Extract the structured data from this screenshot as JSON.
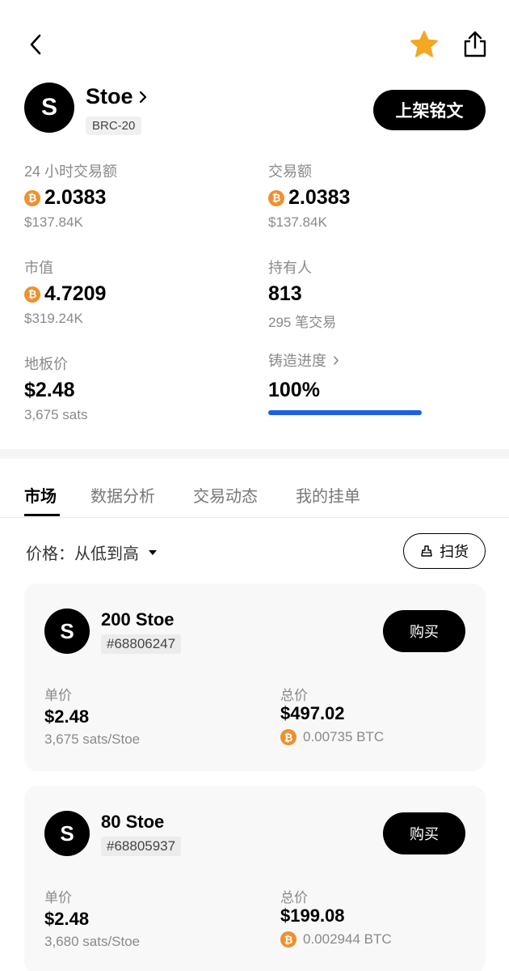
{
  "token": {
    "avatar_letter": "S",
    "name": "Stoe",
    "standard": "BRC-20",
    "list_button": "上架铭文"
  },
  "stats": {
    "volume_24h": {
      "label": "24 小时交易额",
      "value": "2.0383",
      "usd": "$137.84K"
    },
    "volume": {
      "label": "交易额",
      "value": "2.0383",
      "usd": "$137.84K"
    },
    "market_cap": {
      "label": "市值",
      "value": "4.7209",
      "usd": "$319.24K"
    },
    "holders": {
      "label": "持有人",
      "value": "813",
      "sub": "295 笔交易"
    },
    "floor": {
      "label": "地板价",
      "value": "$2.48",
      "sub": "3,675 sats"
    },
    "mint": {
      "label": "铸造进度",
      "value": "100%",
      "progress": 1.0
    }
  },
  "btc_symbol": "₿",
  "tabs": [
    {
      "label": "市场",
      "active": true
    },
    {
      "label": "数据分析",
      "active": false
    },
    {
      "label": "交易动态",
      "active": false
    },
    {
      "label": "我的挂单",
      "active": false
    }
  ],
  "sort": {
    "label": "价格：从低到高"
  },
  "sweep_button": "扫货",
  "listings": [
    {
      "avatar_letter": "S",
      "title": "200 Stoe",
      "id": "#68806247",
      "buy_label": "购买",
      "unit_label": "单价",
      "unit_price": "$2.48",
      "unit_sats": "3,675 sats/Stoe",
      "total_label": "总价",
      "total_price": "$497.02",
      "total_btc": "0.00735 BTC"
    },
    {
      "avatar_letter": "S",
      "title": "80 Stoe",
      "id": "#68805937",
      "buy_label": "购买",
      "unit_label": "单价",
      "unit_price": "$2.48",
      "unit_sats": "3,680 sats/Stoe",
      "total_label": "总价",
      "total_price": "$199.08",
      "total_btc": "0.002944 BTC"
    }
  ],
  "colors": {
    "accent_blue": "#1a5eea",
    "star_gold": "#f5a623",
    "btc_orange": "#f0902c"
  }
}
